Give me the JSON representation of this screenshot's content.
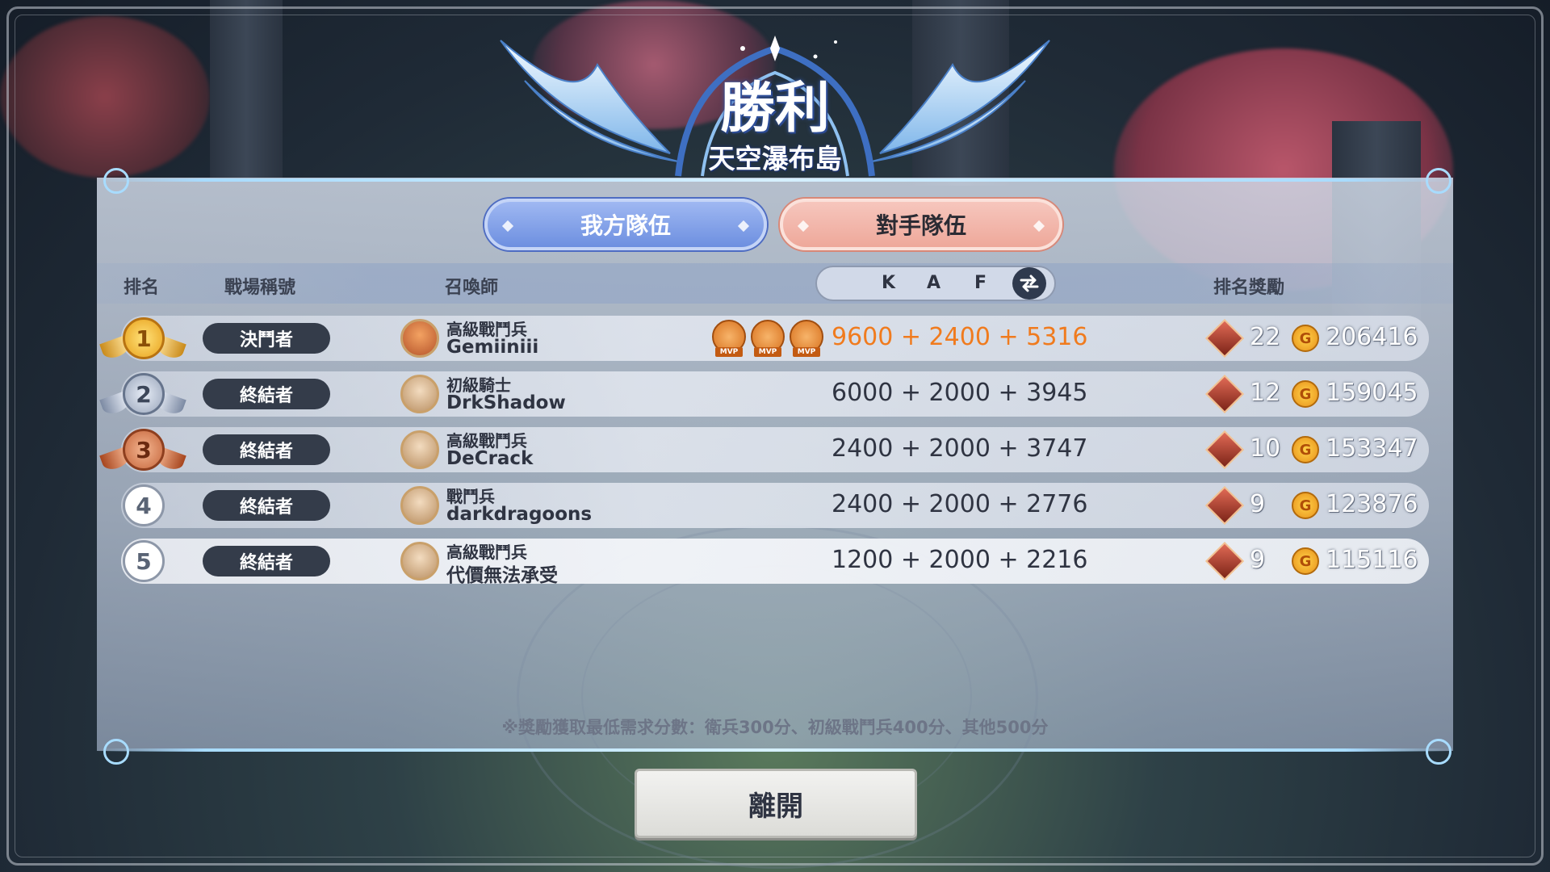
{
  "header": {
    "title": "勝利",
    "subtitle": "天空瀑布島"
  },
  "tabs": [
    {
      "label": "我方隊伍",
      "active": true
    },
    {
      "label": "對手隊伍",
      "active": false
    }
  ],
  "columns": {
    "rank": "排名",
    "battle_title": "戰場稱號",
    "summoner": "召喚師",
    "kaf": [
      "K",
      "A",
      "F"
    ],
    "reward": "排名獎勵"
  },
  "rows": [
    {
      "rank": "1",
      "title": "決鬥者",
      "tier": "高級戰鬥兵",
      "name": "Gemiiniii",
      "score": "9600 + 2400 + 5316",
      "mvp_count": 3,
      "highlight": true,
      "gems": "22",
      "coins": "206416"
    },
    {
      "rank": "2",
      "title": "終結者",
      "tier": "初級騎士",
      "name": "DrkShadow",
      "score": "6000 + 2000 + 3945",
      "mvp_count": 0,
      "highlight": false,
      "gems": "12",
      "coins": "159045"
    },
    {
      "rank": "3",
      "title": "終結者",
      "tier": "高級戰鬥兵",
      "name": "DeCrack",
      "score": "2400 + 2000 + 3747",
      "mvp_count": 0,
      "highlight": false,
      "gems": "10",
      "coins": "153347"
    },
    {
      "rank": "4",
      "title": "終結者",
      "tier": "戰鬥兵",
      "name": "darkdragoons",
      "score": "2400 + 2000 + 2776",
      "mvp_count": 0,
      "highlight": false,
      "gems": "9",
      "coins": "123876"
    },
    {
      "rank": "5",
      "title": "終結者",
      "tier": "高級戰鬥兵",
      "name": "代價無法承受",
      "score": "1200 + 2000 + 2216",
      "mvp_count": 0,
      "highlight": false,
      "gems": "9",
      "coins": "115116"
    }
  ],
  "mvp_label": "MVP",
  "coin_glyph": "G",
  "note": "※獎勵獲取最低需求分數：衛兵300分、初級戰鬥兵400分、其他500分",
  "leave_button": "離開",
  "colors": {
    "accent_blue": "#6d8fe0",
    "accent_pink": "#eea89a",
    "highlight_orange": "#f07b1e",
    "title_pill": "#343c4a"
  },
  "icons": {
    "swap": "swap-arrows-icon",
    "gem": "gem-icon",
    "coin": "coin-icon",
    "mvp": "mvp-medal-icon"
  }
}
